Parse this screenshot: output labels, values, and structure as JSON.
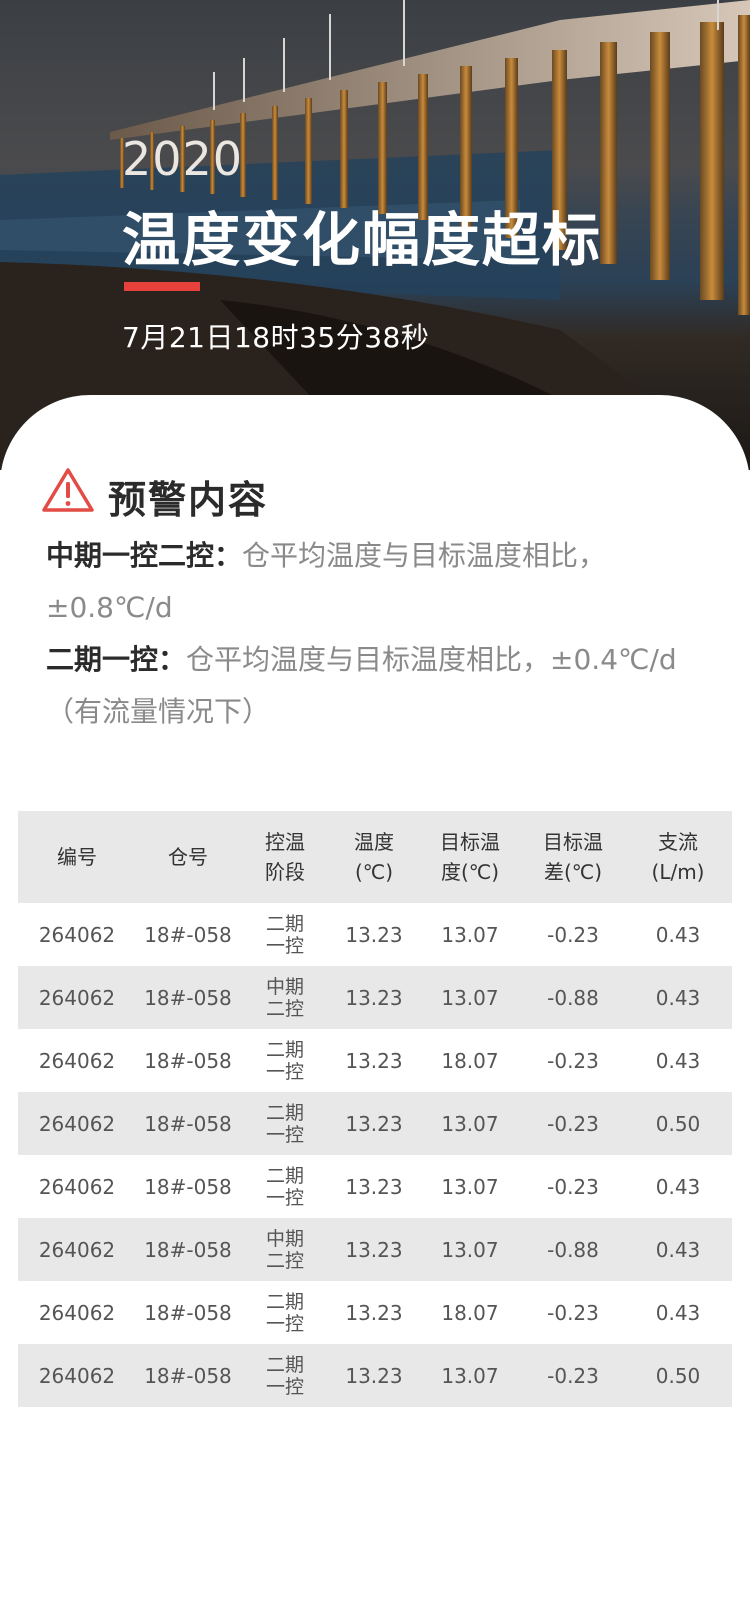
{
  "hero": {
    "year": "2020",
    "title": "温度变化幅度超标",
    "time": "7月21日18时35分38秒"
  },
  "warning": {
    "icon": "warning-triangle-icon",
    "title": "预警内容",
    "rules": [
      {
        "label": "中期一控二控：",
        "text": "仓平均温度与目标温度相比，±0.8℃/d"
      },
      {
        "label": "二期一控：",
        "text": "仓平均温度与目标温度相比，±0.4℃/d（有流量情况下）"
      }
    ]
  },
  "table": {
    "headers": [
      "编号",
      "仓号",
      "控温阶段",
      "温度(℃)",
      "目标温度(℃)",
      "目标温差(℃)",
      "支流(L/m)"
    ],
    "rows": [
      {
        "id": "264062",
        "bin": "18#-058",
        "stage": "二期一控",
        "temp": "13.23",
        "target": "13.07",
        "diff": "-0.23",
        "flow": "0.43"
      },
      {
        "id": "264062",
        "bin": "18#-058",
        "stage": "中期二控",
        "temp": "13.23",
        "target": "13.07",
        "diff": "-0.88",
        "flow": "0.43"
      },
      {
        "id": "264062",
        "bin": "18#-058",
        "stage": "二期一控",
        "temp": "13.23",
        "target": "18.07",
        "diff": "-0.23",
        "flow": "0.43"
      },
      {
        "id": "264062",
        "bin": "18#-058",
        "stage": "二期一控",
        "temp": "13.23",
        "target": "13.07",
        "diff": "-0.23",
        "flow": "0.50"
      },
      {
        "id": "264062",
        "bin": "18#-058",
        "stage": "二期一控",
        "temp": "13.23",
        "target": "13.07",
        "diff": "-0.23",
        "flow": "0.43"
      },
      {
        "id": "264062",
        "bin": "18#-058",
        "stage": "中期二控",
        "temp": "13.23",
        "target": "13.07",
        "diff": "-0.88",
        "flow": "0.43"
      },
      {
        "id": "264062",
        "bin": "18#-058",
        "stage": "二期一控",
        "temp": "13.23",
        "target": "18.07",
        "diff": "-0.23",
        "flow": "0.43"
      },
      {
        "id": "264062",
        "bin": "18#-058",
        "stage": "二期一控",
        "temp": "13.23",
        "target": "13.07",
        "diff": "-0.23",
        "flow": "0.50"
      }
    ]
  },
  "colors": {
    "accent": "#e8403a",
    "warning": "#e24c45",
    "row_alt": "#e8e8e8",
    "label": "#2b2b2b",
    "muted": "#8a8a8a"
  }
}
